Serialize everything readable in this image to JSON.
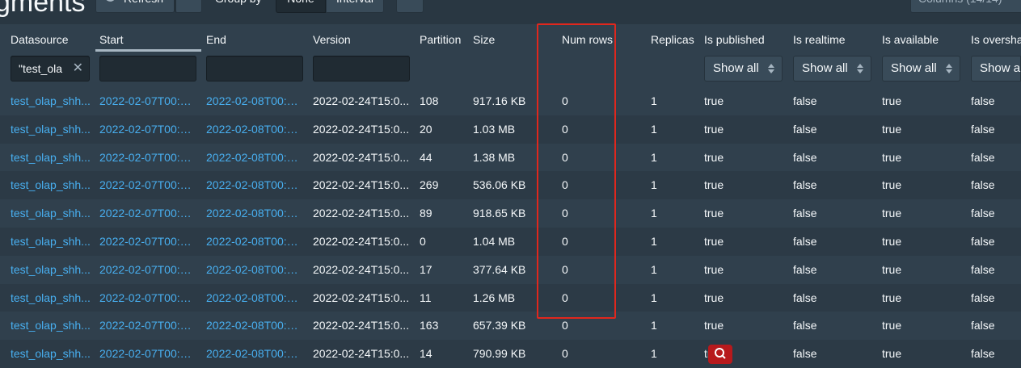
{
  "page": {
    "title": "gments"
  },
  "toolbar": {
    "refresh_label": "Refresh",
    "group_by_label": "Group by",
    "group_none_label": "None",
    "group_interval_label": "Interval",
    "more_label": "···",
    "columns_label": "Columns (14/14)"
  },
  "columns": {
    "datasource": "Datasource",
    "start": "Start",
    "end": "End",
    "version": "Version",
    "partition": "Partition",
    "size": "Size",
    "num_rows": "Num rows",
    "replicas": "Replicas",
    "is_published": "Is published",
    "is_realtime": "Is realtime",
    "is_available": "Is available",
    "is_overshadowed": "Is oversha"
  },
  "filters": {
    "datasource_value": "\"test_ola",
    "is_published": "Show all",
    "is_realtime": "Show all",
    "is_available": "Show all",
    "is_overshadowed": "Show al"
  },
  "rows": [
    {
      "datasource": "test_olap_shh...",
      "start": "2022-02-07T00:0...",
      "end": "2022-02-08T00:0...",
      "version": "2022-02-24T15:0...",
      "partition": "108",
      "size": "917.16 KB",
      "num_rows": "0",
      "replicas": "1",
      "is_published": "true",
      "is_realtime": "false",
      "is_available": "true",
      "is_overshadowed": "false"
    },
    {
      "datasource": "test_olap_shh...",
      "start": "2022-02-07T00:0...",
      "end": "2022-02-08T00:0...",
      "version": "2022-02-24T15:0...",
      "partition": "20",
      "size": "1.03 MB",
      "num_rows": "0",
      "replicas": "1",
      "is_published": "true",
      "is_realtime": "false",
      "is_available": "true",
      "is_overshadowed": "false"
    },
    {
      "datasource": "test_olap_shh...",
      "start": "2022-02-07T00:0...",
      "end": "2022-02-08T00:0...",
      "version": "2022-02-24T15:0...",
      "partition": "44",
      "size": "1.38 MB",
      "num_rows": "0",
      "replicas": "1",
      "is_published": "true",
      "is_realtime": "false",
      "is_available": "true",
      "is_overshadowed": "false"
    },
    {
      "datasource": "test_olap_shh...",
      "start": "2022-02-07T00:0...",
      "end": "2022-02-08T00:0...",
      "version": "2022-02-24T15:0...",
      "partition": "269",
      "size": "536.06 KB",
      "num_rows": "0",
      "replicas": "1",
      "is_published": "true",
      "is_realtime": "false",
      "is_available": "true",
      "is_overshadowed": "false"
    },
    {
      "datasource": "test_olap_shh...",
      "start": "2022-02-07T00:0...",
      "end": "2022-02-08T00:0...",
      "version": "2022-02-24T15:0...",
      "partition": "89",
      "size": "918.65 KB",
      "num_rows": "0",
      "replicas": "1",
      "is_published": "true",
      "is_realtime": "false",
      "is_available": "true",
      "is_overshadowed": "false"
    },
    {
      "datasource": "test_olap_shh...",
      "start": "2022-02-07T00:0...",
      "end": "2022-02-08T00:0...",
      "version": "2022-02-24T15:0...",
      "partition": "0",
      "size": "1.04 MB",
      "num_rows": "0",
      "replicas": "1",
      "is_published": "true",
      "is_realtime": "false",
      "is_available": "true",
      "is_overshadowed": "false"
    },
    {
      "datasource": "test_olap_shh...",
      "start": "2022-02-07T00:0...",
      "end": "2022-02-08T00:0...",
      "version": "2022-02-24T15:0...",
      "partition": "17",
      "size": "377.64 KB",
      "num_rows": "0",
      "replicas": "1",
      "is_published": "true",
      "is_realtime": "false",
      "is_available": "true",
      "is_overshadowed": "false"
    },
    {
      "datasource": "test_olap_shh...",
      "start": "2022-02-07T00:0...",
      "end": "2022-02-08T00:0...",
      "version": "2022-02-24T15:0...",
      "partition": "11",
      "size": "1.26 MB",
      "num_rows": "0",
      "replicas": "1",
      "is_published": "true",
      "is_realtime": "false",
      "is_available": "true",
      "is_overshadowed": "false"
    },
    {
      "datasource": "test_olap_shh...",
      "start": "2022-02-07T00:0...",
      "end": "2022-02-08T00:0...",
      "version": "2022-02-24T15:0...",
      "partition": "163",
      "size": "657.39 KB",
      "num_rows": "0",
      "replicas": "1",
      "is_published": "true",
      "is_realtime": "false",
      "is_available": "true",
      "is_overshadowed": "false"
    },
    {
      "datasource": "test_olap_shh...",
      "start": "2022-02-07T00:0...",
      "end": "2022-02-08T00:0...",
      "version": "2022-02-24T15:0...",
      "partition": "14",
      "size": "790.99 KB",
      "num_rows": "0",
      "replicas": "1",
      "is_published": "true",
      "is_realtime": "false",
      "is_available": "true",
      "is_overshadowed": "false"
    }
  ],
  "icons": {
    "refresh": "refresh-icon",
    "caret": "caret-down-icon",
    "clear": "clear-icon",
    "select_arrows": "double-caret-icon",
    "badge": "search-badge-icon"
  },
  "colors": {
    "background": "#30404d",
    "row_alt": "#2c3a46",
    "link": "#48aff0",
    "annotation": "#e0271d",
    "badge": "#b7191c"
  }
}
